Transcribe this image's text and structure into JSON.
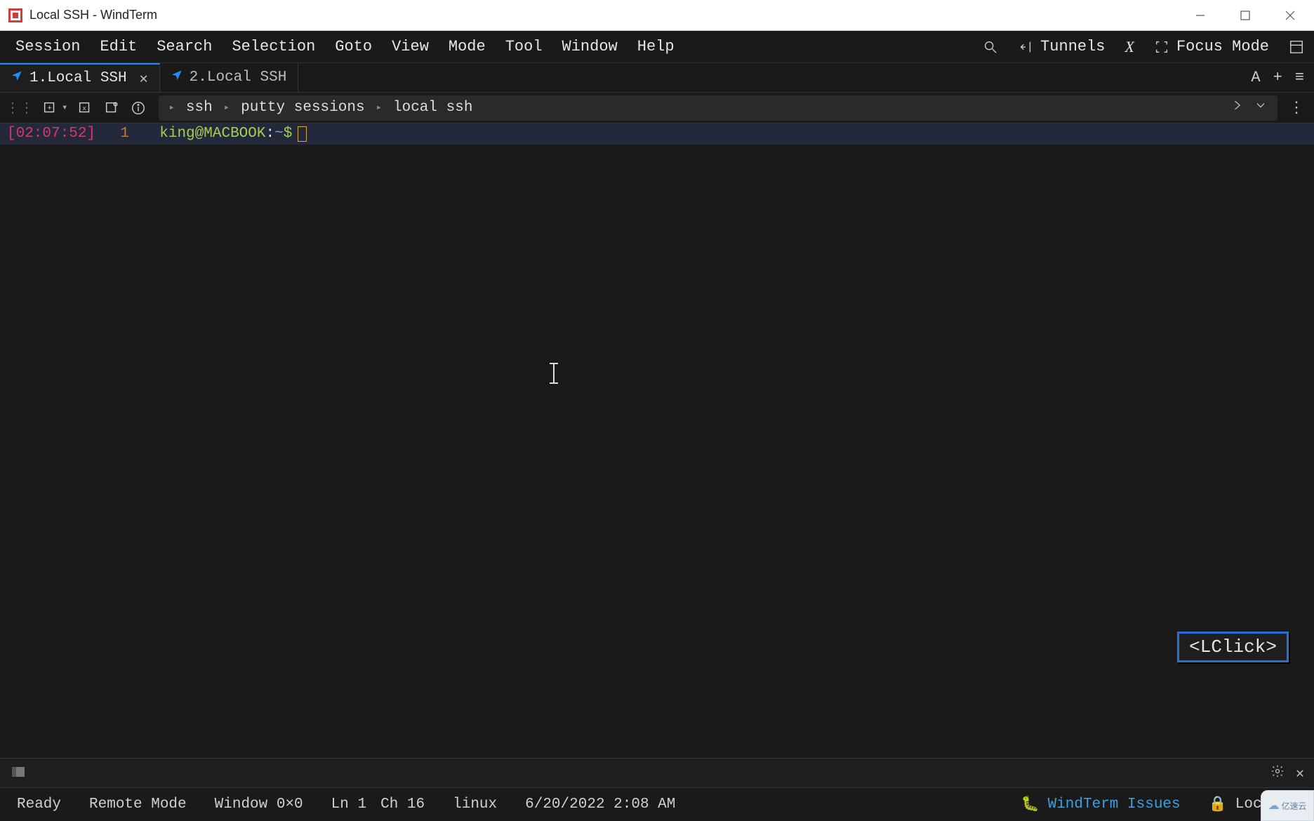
{
  "window": {
    "title": "Local SSH - WindTerm"
  },
  "menubar": {
    "items": [
      "Session",
      "Edit",
      "Search",
      "Selection",
      "Goto",
      "View",
      "Mode",
      "Tool",
      "Window",
      "Help"
    ],
    "right": {
      "tunnels": "Tunnels",
      "focus_mode": "Focus Mode"
    }
  },
  "tabs": [
    {
      "label": "1.Local SSH",
      "active": true,
      "closable": true
    },
    {
      "label": "2.Local SSH",
      "active": false,
      "closable": false
    }
  ],
  "tabbar_actions": {
    "font": "A",
    "add": "+",
    "menu": "≡"
  },
  "breadcrumb": {
    "items": [
      "ssh",
      "putty sessions",
      "local ssh"
    ]
  },
  "terminal": {
    "timestamp": "[02:07:52]",
    "line_number": "1",
    "prompt_user": "king@MACBOOK",
    "prompt_colon": ":",
    "prompt_path": "~",
    "prompt_dollar": "$"
  },
  "lclick_badge": "<LClick>",
  "statusbar": {
    "ready": "Ready",
    "remote_mode": "Remote Mode",
    "window_size": "Window 0×0",
    "ln": "Ln 1",
    "ch": "Ch 16",
    "platform": "linux",
    "datetime": "6/20/2022 2:08 AM",
    "issues": "WindTerm Issues",
    "lock": "Lock Sc"
  },
  "watermark": "亿速云"
}
